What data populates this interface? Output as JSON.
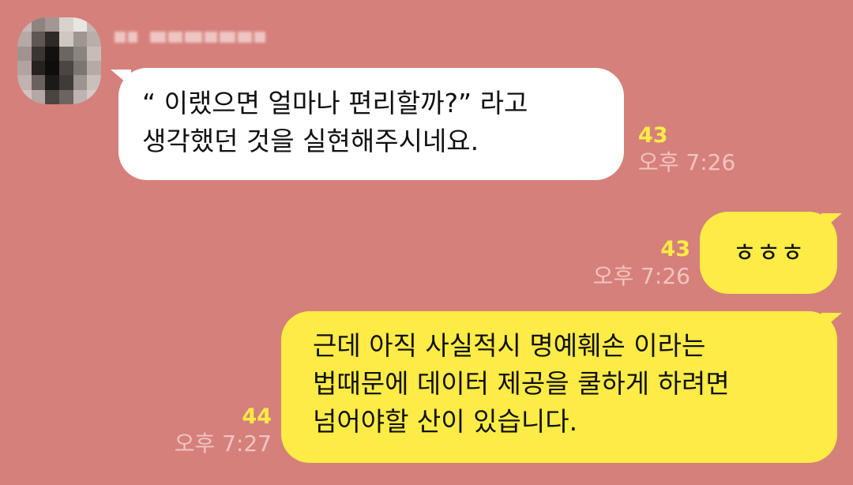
{
  "colors": {
    "background": "#d5807b",
    "incoming_bubble": "#ffffff",
    "outgoing_bubble": "#fdeb46",
    "unread_count": "#fdeb46",
    "timestamp": "#f2c4c0"
  },
  "messages": [
    {
      "direction": "incoming",
      "lines": [
        "“ 이랬으면 얼마나 편리할까?” 라고",
        "생각했던 것을 실현해주시네요."
      ],
      "unread_count": "43",
      "time": "오후 7:26"
    },
    {
      "direction": "outgoing",
      "lines": [
        "ㅎㅎㅎ"
      ],
      "unread_count": "43",
      "time": "오후 7:26"
    },
    {
      "direction": "outgoing",
      "lines": [
        "근데 아직 사실적시 명예훼손 이라는",
        "법때문에 데이터 제공을 쿨하게 하려면",
        "넘어야할 산이 있습니다."
      ],
      "unread_count": "44",
      "time": "오후 7:27"
    }
  ]
}
